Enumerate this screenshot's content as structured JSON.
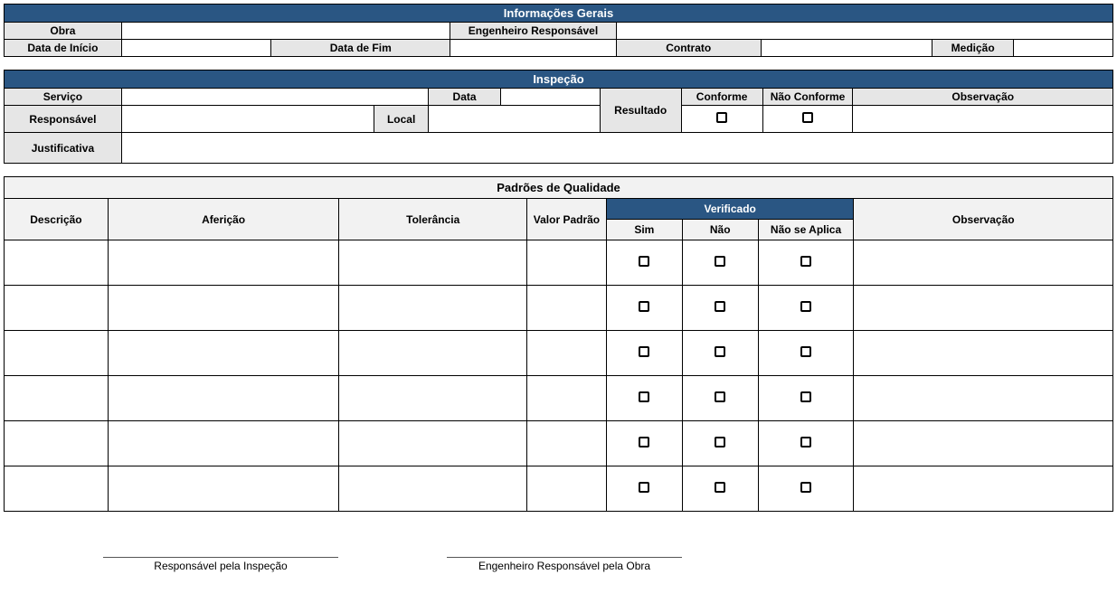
{
  "section1": {
    "title": "Informações Gerais",
    "obra_label": "Obra",
    "obra_value": "",
    "eng_label": "Engenheiro Responsável",
    "eng_value": "",
    "inicio_label": "Data de Início",
    "inicio_value": "",
    "fim_label": "Data de Fim",
    "fim_value": "",
    "contrato_label": "Contrato",
    "contrato_value": "",
    "medicao_label": "Medição",
    "medicao_value": ""
  },
  "section2": {
    "title": "Inspeção",
    "servico_label": "Serviço",
    "servico_value": "",
    "data_label": "Data",
    "data_value": "",
    "resultado_label": "Resultado",
    "conforme_label": "Conforme",
    "nao_conforme_label": "Não Conforme",
    "observacao_label": "Observação",
    "observacao_value": "",
    "responsavel_label": "Responsável",
    "responsavel_value": "",
    "local_label": "Local",
    "local_value": "",
    "justificativa_label": "Justificativa",
    "justificativa_value": ""
  },
  "section3": {
    "title": "Padrões de Qualidade",
    "cols": {
      "descricao": "Descrição",
      "afericao": "Aferição",
      "tolerancia": "Tolerância",
      "valor_padrao": "Valor Padrão",
      "verificado": "Verificado",
      "sim": "Sim",
      "nao": "Não",
      "na": "Não se Aplica",
      "observacao": "Observação"
    },
    "rows": [
      {
        "descricao": "",
        "afericao": "",
        "tolerancia": "",
        "valor_padrao": "",
        "observacao": ""
      },
      {
        "descricao": "",
        "afericao": "",
        "tolerancia": "",
        "valor_padrao": "",
        "observacao": ""
      },
      {
        "descricao": "",
        "afericao": "",
        "tolerancia": "",
        "valor_padrao": "",
        "observacao": ""
      },
      {
        "descricao": "",
        "afericao": "",
        "tolerancia": "",
        "valor_padrao": "",
        "observacao": ""
      },
      {
        "descricao": "",
        "afericao": "",
        "tolerancia": "",
        "valor_padrao": "",
        "observacao": ""
      },
      {
        "descricao": "",
        "afericao": "",
        "tolerancia": "",
        "valor_padrao": "",
        "observacao": ""
      }
    ]
  },
  "signatures": {
    "inspecao": "Responsável pela Inspeção",
    "obra": "Engenheiro Responsável pela Obra"
  }
}
